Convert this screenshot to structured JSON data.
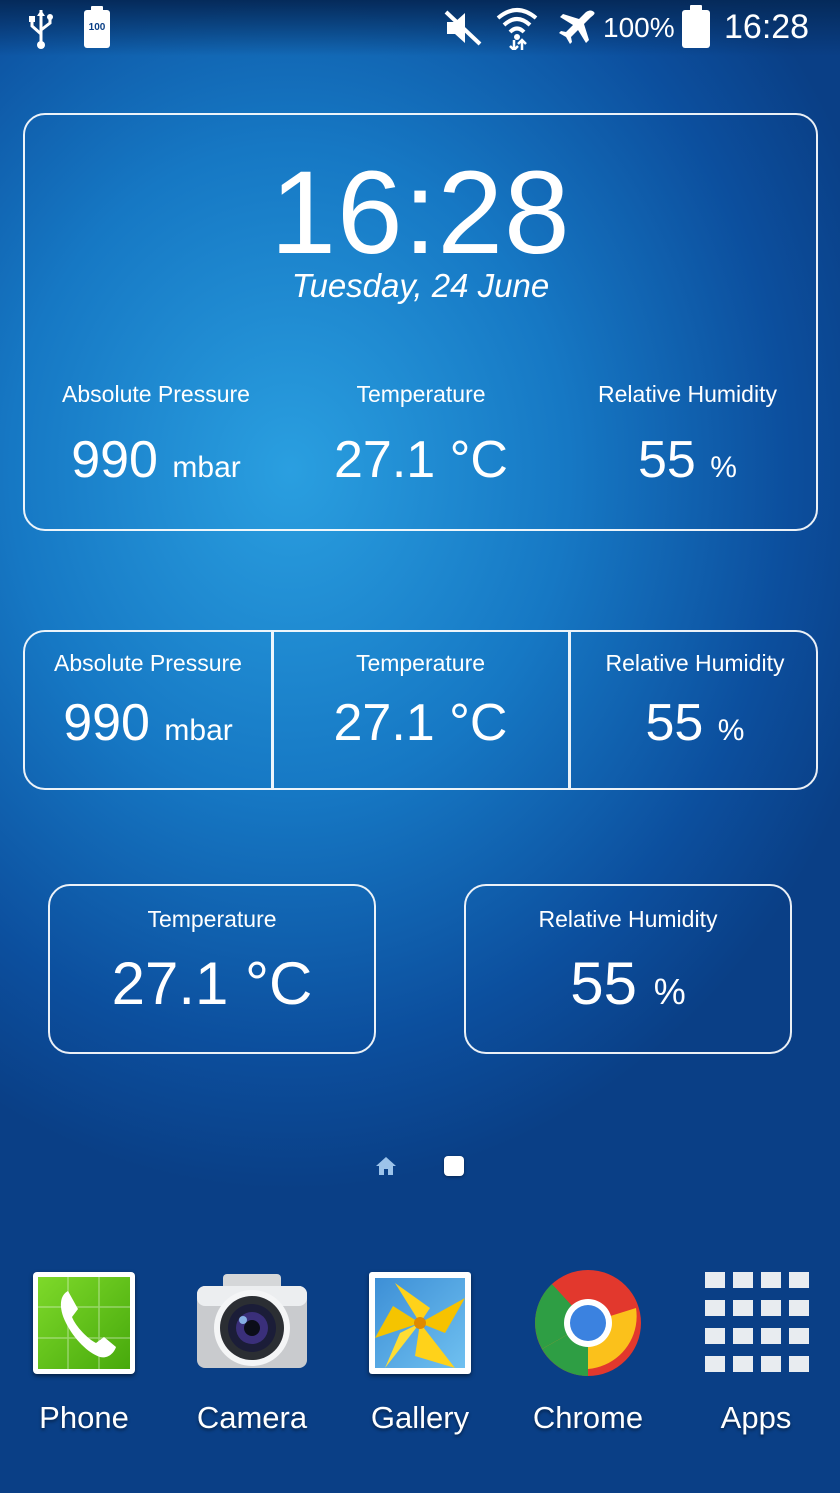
{
  "status_bar": {
    "icons": [
      "usb-icon",
      "battery-saver-icon",
      "mute-icon",
      "wifi-icon",
      "airplane-mode-icon",
      "battery-icon"
    ],
    "battery_saver_text": "100",
    "battery_percent": "100%",
    "time": "16:28"
  },
  "widget_large": {
    "time": "16:28",
    "date": "Tuesday, 24 June",
    "pressure": {
      "label": "Absolute Pressure",
      "value": "990",
      "unit": "mbar"
    },
    "temperature": {
      "label": "Temperature",
      "value": "27.1 °C"
    },
    "humidity": {
      "label": "Relative Humidity",
      "value": "55",
      "unit": "%"
    }
  },
  "widget_row": {
    "pressure": {
      "label": "Absolute Pressure",
      "value": "990",
      "unit": "mbar"
    },
    "temperature": {
      "label": "Temperature",
      "value": "27.1 °C"
    },
    "humidity": {
      "label": "Relative Humidity",
      "value": "55",
      "unit": "%"
    }
  },
  "widget_temperature": {
    "label": "Temperature",
    "value": "27.1 °C"
  },
  "widget_humidity": {
    "label": "Relative Humidity",
    "value": "55",
    "unit": "%"
  },
  "page_indicator": {
    "pages": [
      "home-icon",
      "page-dot"
    ],
    "active_page": 2
  },
  "dock": [
    {
      "label": "Phone",
      "icon": "phone-icon",
      "color": "#5cc41a"
    },
    {
      "label": "Camera",
      "icon": "camera-icon"
    },
    {
      "label": "Gallery",
      "icon": "gallery-icon"
    },
    {
      "label": "Chrome",
      "icon": "chrome-icon"
    },
    {
      "label": "Apps",
      "icon": "apps-grid-icon"
    }
  ]
}
